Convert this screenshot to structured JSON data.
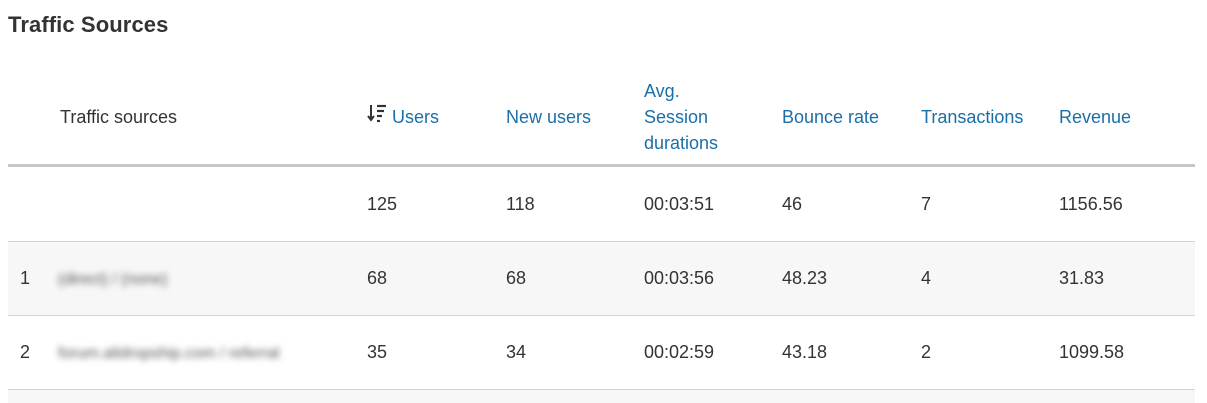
{
  "page": {
    "title": "Traffic Sources"
  },
  "table": {
    "columns": {
      "source": "Traffic sources",
      "users": "Users",
      "new_users": "New users",
      "avg_session_line1": "Avg.",
      "avg_session_line2": "Session",
      "avg_session_line3": "durations",
      "bounce_rate": "Bounce rate",
      "transactions": "Transactions",
      "revenue": "Revenue"
    },
    "sort": {
      "column": "users",
      "direction": "descending",
      "icon": "sort-descending-icon"
    },
    "totals": {
      "users": "125",
      "new_users": "118",
      "avg_session": "00:03:51",
      "bounce_rate": "46",
      "transactions": "7",
      "revenue": "1156.56"
    },
    "rows": [
      {
        "index": "1",
        "source": "(direct) / (none)",
        "users": "68",
        "new_users": "68",
        "avg_session": "00:03:56",
        "bounce_rate": "48.23",
        "transactions": "4",
        "revenue": "31.83"
      },
      {
        "index": "2",
        "source": "forum.alidropship.com / referral",
        "users": "35",
        "new_users": "34",
        "avg_session": "00:02:59",
        "bounce_rate": "43.18",
        "transactions": "2",
        "revenue": "1099.58"
      }
    ]
  },
  "colors": {
    "header_link": "#1a6fa8",
    "text": "#333333",
    "row_shade": "#f7f7f7",
    "header_rule": "#c7c7c7"
  }
}
